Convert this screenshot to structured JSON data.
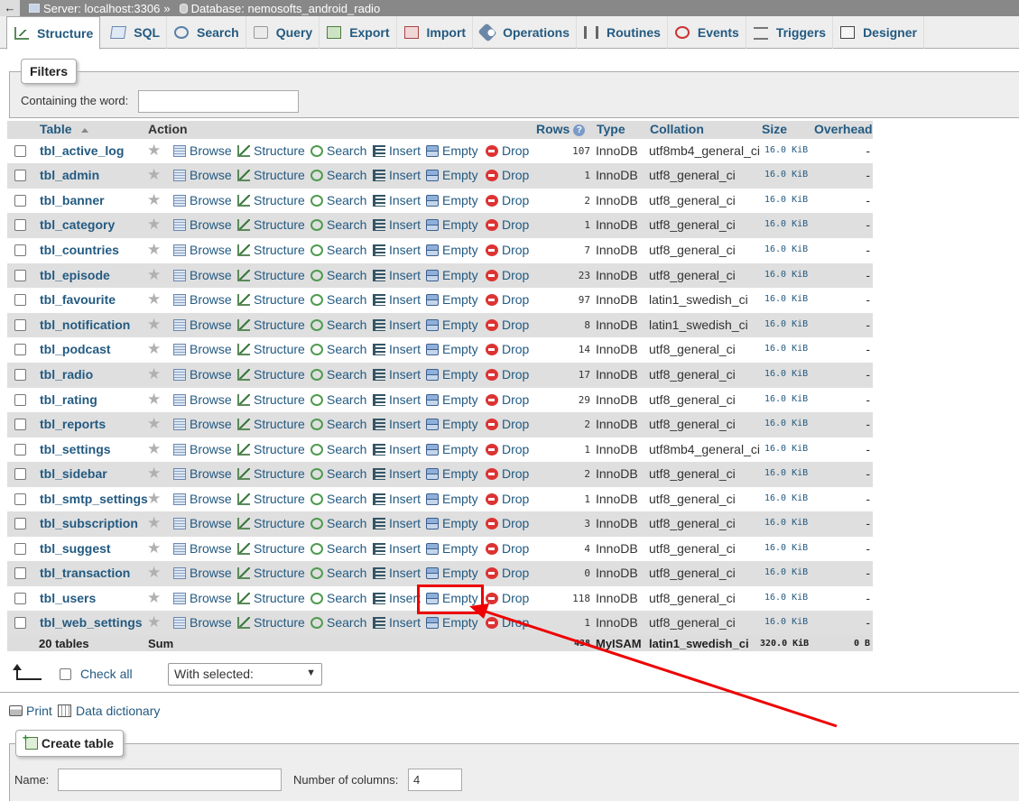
{
  "topbar": {
    "back": "←",
    "server": "Server: localhost:3306",
    "sep": "»",
    "database": "Database: nemosofts_android_radio"
  },
  "tabs": [
    {
      "label": "Structure",
      "icon": "structure-icon",
      "active": true
    },
    {
      "label": "SQL",
      "icon": "sql-icon"
    },
    {
      "label": "Search",
      "icon": "search-icon"
    },
    {
      "label": "Query",
      "icon": "query-icon"
    },
    {
      "label": "Export",
      "icon": "export-icon"
    },
    {
      "label": "Import",
      "icon": "import-icon"
    },
    {
      "label": "Operations",
      "icon": "operations-icon"
    },
    {
      "label": "Routines",
      "icon": "routines-icon"
    },
    {
      "label": "Events",
      "icon": "events-icon"
    },
    {
      "label": "Triggers",
      "icon": "triggers-icon"
    },
    {
      "label": "Designer",
      "icon": "designer-icon"
    }
  ],
  "filters": {
    "legend": "Filters",
    "label": "Containing the word:",
    "value": ""
  },
  "table": {
    "headers": {
      "table": "Table",
      "action": "Action",
      "rows": "Rows",
      "help": "?",
      "type": "Type",
      "collation": "Collation",
      "size": "Size",
      "overhead": "Overhead"
    },
    "actions": {
      "browse": "Browse",
      "structure": "Structure",
      "search": "Search",
      "insert": "Insert",
      "empty": "Empty",
      "drop": "Drop"
    },
    "star": "★",
    "rows": [
      {
        "name": "tbl_active_log",
        "rows": "107",
        "type": "InnoDB",
        "collation": "utf8mb4_general_ci",
        "size": "16.0 KiB",
        "overhead": "-"
      },
      {
        "name": "tbl_admin",
        "rows": "1",
        "type": "InnoDB",
        "collation": "utf8_general_ci",
        "size": "16.0 KiB",
        "overhead": "-"
      },
      {
        "name": "tbl_banner",
        "rows": "2",
        "type": "InnoDB",
        "collation": "utf8_general_ci",
        "size": "16.0 KiB",
        "overhead": "-"
      },
      {
        "name": "tbl_category",
        "rows": "1",
        "type": "InnoDB",
        "collation": "utf8_general_ci",
        "size": "16.0 KiB",
        "overhead": "-"
      },
      {
        "name": "tbl_countries",
        "rows": "7",
        "type": "InnoDB",
        "collation": "utf8_general_ci",
        "size": "16.0 KiB",
        "overhead": "-"
      },
      {
        "name": "tbl_episode",
        "rows": "23",
        "type": "InnoDB",
        "collation": "utf8_general_ci",
        "size": "16.0 KiB",
        "overhead": "-"
      },
      {
        "name": "tbl_favourite",
        "rows": "97",
        "type": "InnoDB",
        "collation": "latin1_swedish_ci",
        "size": "16.0 KiB",
        "overhead": "-"
      },
      {
        "name": "tbl_notification",
        "rows": "8",
        "type": "InnoDB",
        "collation": "latin1_swedish_ci",
        "size": "16.0 KiB",
        "overhead": "-"
      },
      {
        "name": "tbl_podcast",
        "rows": "14",
        "type": "InnoDB",
        "collation": "utf8_general_ci",
        "size": "16.0 KiB",
        "overhead": "-"
      },
      {
        "name": "tbl_radio",
        "rows": "17",
        "type": "InnoDB",
        "collation": "utf8_general_ci",
        "size": "16.0 KiB",
        "overhead": "-"
      },
      {
        "name": "tbl_rating",
        "rows": "29",
        "type": "InnoDB",
        "collation": "utf8_general_ci",
        "size": "16.0 KiB",
        "overhead": "-"
      },
      {
        "name": "tbl_reports",
        "rows": "2",
        "type": "InnoDB",
        "collation": "utf8_general_ci",
        "size": "16.0 KiB",
        "overhead": "-"
      },
      {
        "name": "tbl_settings",
        "rows": "1",
        "type": "InnoDB",
        "collation": "utf8mb4_general_ci",
        "size": "16.0 KiB",
        "overhead": "-"
      },
      {
        "name": "tbl_sidebar",
        "rows": "2",
        "type": "InnoDB",
        "collation": "utf8_general_ci",
        "size": "16.0 KiB",
        "overhead": "-"
      },
      {
        "name": "tbl_smtp_settings",
        "rows": "1",
        "type": "InnoDB",
        "collation": "utf8_general_ci",
        "size": "16.0 KiB",
        "overhead": "-"
      },
      {
        "name": "tbl_subscription",
        "rows": "3",
        "type": "InnoDB",
        "collation": "utf8_general_ci",
        "size": "16.0 KiB",
        "overhead": "-"
      },
      {
        "name": "tbl_suggest",
        "rows": "4",
        "type": "InnoDB",
        "collation": "utf8_general_ci",
        "size": "16.0 KiB",
        "overhead": "-"
      },
      {
        "name": "tbl_transaction",
        "rows": "0",
        "type": "InnoDB",
        "collation": "utf8_general_ci",
        "size": "16.0 KiB",
        "overhead": "-"
      },
      {
        "name": "tbl_users",
        "rows": "118",
        "type": "InnoDB",
        "collation": "utf8_general_ci",
        "size": "16.0 KiB",
        "overhead": "-"
      },
      {
        "name": "tbl_web_settings",
        "rows": "1",
        "type": "InnoDB",
        "collation": "utf8_general_ci",
        "size": "16.0 KiB",
        "overhead": "-"
      }
    ],
    "summary": {
      "count": "20 tables",
      "label": "Sum",
      "rows": "438",
      "type": "MyISAM",
      "collation": "latin1_swedish_ci",
      "size": "320.0 KiB",
      "overhead": "0 B"
    }
  },
  "bulk": {
    "check_all": "Check all",
    "with_selected": "With selected:",
    "chevron": "▼"
  },
  "links": {
    "print": "Print",
    "data_dictionary": "Data dictionary"
  },
  "create": {
    "legend": "Create table",
    "name_label": "Name:",
    "name_value": "",
    "columns_label": "Number of columns:",
    "columns_value": "4"
  },
  "colors": {
    "link": "#235a81",
    "header_bg": "#dddddd",
    "alt_row": "#dfdfdf",
    "annotation": "#ee0000"
  }
}
